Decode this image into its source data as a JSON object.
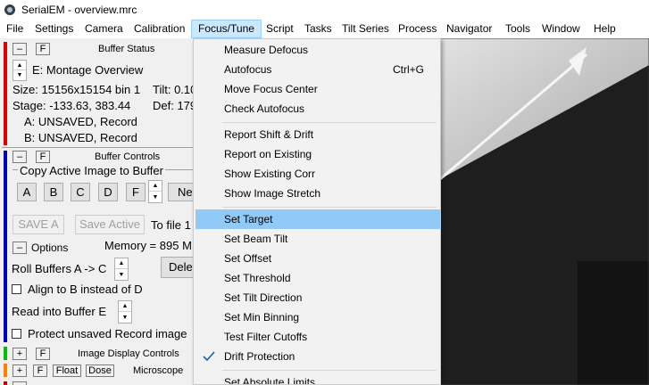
{
  "window": {
    "title": "SerialEM  -  overview.mrc",
    "app_icon": "serialem-app-icon"
  },
  "menubar": {
    "items": [
      "File",
      "Settings",
      "Camera",
      "Calibration",
      "Focus/Tune",
      "Script",
      "Tasks",
      "Tilt Series",
      "Process",
      "Navigator",
      "Tools",
      "Window",
      "Help"
    ],
    "active": "Focus/Tune"
  },
  "buffer_status": {
    "minus": "–",
    "f": "F",
    "title": "Buffer Status",
    "current": "E: Montage Overview",
    "size": "Size: 15156x15154  bin 1",
    "tilt": "Tilt: 0.10",
    "stage": "Stage: -133.63, 383.44",
    "def": "Def: 179",
    "buf_a": "A: UNSAVED, Record",
    "buf_b": "B: UNSAVED, Record",
    "accent_color": "#e00000"
  },
  "buffer_controls": {
    "minus": "–",
    "f": "F",
    "title": "Buffer Controls",
    "copy_label": "Copy Active Image to Buffer",
    "buffers": [
      "A",
      "B",
      "C",
      "D",
      "F"
    ],
    "new_label": "Ne",
    "save_a": "SAVE A",
    "save_active": "Save Active",
    "to_file": "To file 1",
    "options": "Options",
    "memory": "Memory = 895 M",
    "roll_label": "Roll Buffers A ->  C",
    "delete_label": "Dele",
    "align_label": "Align to B instead of D",
    "read_label": "Read into Buffer   E",
    "protect_label": "Protect unsaved Record image",
    "accent_color": "#0000c0"
  },
  "image_display": {
    "plus": "+",
    "f": "F",
    "title": "Image Display Controls",
    "accent_color": "#00c000"
  },
  "microscope": {
    "plus": "+",
    "f": "F",
    "float": "Float",
    "dose": "Dose",
    "title": "Microscope",
    "accent_color": "#ff8000"
  },
  "dropdown": {
    "groups": [
      [
        {
          "label": "Measure Defocus"
        },
        {
          "label": "Autofocus",
          "shortcut": "Ctrl+G"
        },
        {
          "label": "Move Focus Center"
        },
        {
          "label": "Check Autofocus"
        }
      ],
      [
        {
          "label": "Report Shift & Drift"
        },
        {
          "label": "Report on Existing"
        },
        {
          "label": "Show Existing Corr"
        },
        {
          "label": "Show Image Stretch"
        }
      ],
      [
        {
          "label": "Set Target",
          "highlighted": true
        },
        {
          "label": "Set Beam Tilt"
        },
        {
          "label": "Set Offset"
        },
        {
          "label": "Set Threshold"
        },
        {
          "label": "Set Tilt Direction"
        },
        {
          "label": "Set Min Binning"
        },
        {
          "label": "Test Filter Cutoffs"
        },
        {
          "label": "Drift Protection",
          "checked": true
        }
      ],
      [
        {
          "label": "Set Absolute Limits"
        }
      ]
    ]
  }
}
